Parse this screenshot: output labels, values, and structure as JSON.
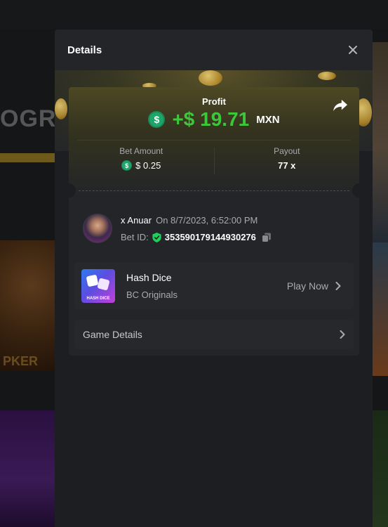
{
  "background": {
    "logo_fragment": "OGR",
    "game_fragment": "PKER"
  },
  "modal": {
    "title": "Details",
    "close_icon": "close-icon"
  },
  "profit": {
    "label": "Profit",
    "value": "+$ 19.71",
    "currency": "MXN",
    "coin_symbol": "$",
    "share_icon": "share-icon",
    "value_color": "#3bc93b"
  },
  "bet_amount": {
    "label": "Bet Amount",
    "coin_symbol": "$",
    "value": "$ 0.25"
  },
  "payout": {
    "label": "Payout",
    "value": "77 x"
  },
  "user": {
    "name": "x Anuar",
    "date": "On 8/7/2023, 6:52:00 PM",
    "bet_id_label": "Bet ID:",
    "bet_id": "353590179144930276",
    "verified_icon": "shield-check-icon",
    "copy_icon": "copy-icon"
  },
  "game": {
    "name": "Hash Dice",
    "provider": "BC Originals",
    "thumb_label": "HASH DICE",
    "action": "Play Now"
  },
  "game_details": {
    "label": "Game Details"
  }
}
